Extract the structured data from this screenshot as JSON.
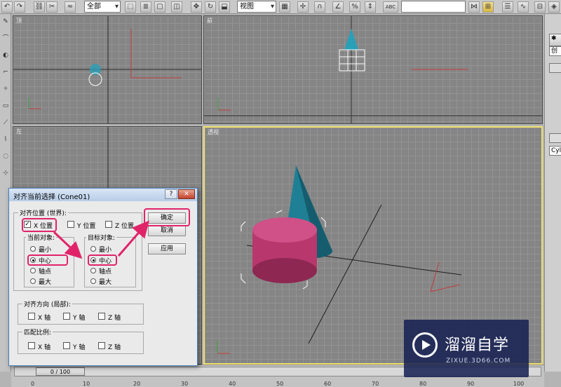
{
  "toolbar": {
    "selection_filter": "全部",
    "reference_coord": "视图",
    "abc_label": "ABC"
  },
  "right_panel": {
    "top_field": "创",
    "name_field": "Cyl"
  },
  "viewports": {
    "top": "顶",
    "front": "前",
    "left": "左",
    "perspective": "透视"
  },
  "colors": {
    "viewport_bg": "#858585",
    "active_viewport_border": "#f0e06a",
    "highlight": "#e0246a",
    "cone": "#1f7f95",
    "cylinder": "#b8376c"
  },
  "timeline": {
    "frame_display": "0 / 100",
    "ticks": [
      "0",
      "10",
      "20",
      "30",
      "40",
      "50",
      "60",
      "70",
      "80",
      "90",
      "100"
    ]
  },
  "dialog": {
    "title": "对齐当前选择 (Cone01)",
    "help": "?",
    "close": "✕",
    "align_position_label": "对齐位置 (世界):",
    "x_position": "X 位置",
    "y_position": "Y 位置",
    "z_position": "Z 位置",
    "current_object_label": "当前对象:",
    "target_object_label": "目标对象:",
    "current_options": [
      "最小",
      "中心",
      "轴点",
      "最大"
    ],
    "target_options": [
      "最小",
      "中心",
      "轴点",
      "最大"
    ],
    "current_selected": "中心",
    "target_selected": "中心",
    "align_orientation_label": "对齐方向 (局部):",
    "match_scale_label": "匹配比例:",
    "axes": [
      "X 轴",
      "Y 轴",
      "Z 轴"
    ],
    "ok_button": "确定",
    "cancel_button": "取消",
    "apply_button": "应用"
  },
  "watermark": {
    "title": "溜溜自学",
    "url": "ZIXUE.3D66.COM"
  }
}
